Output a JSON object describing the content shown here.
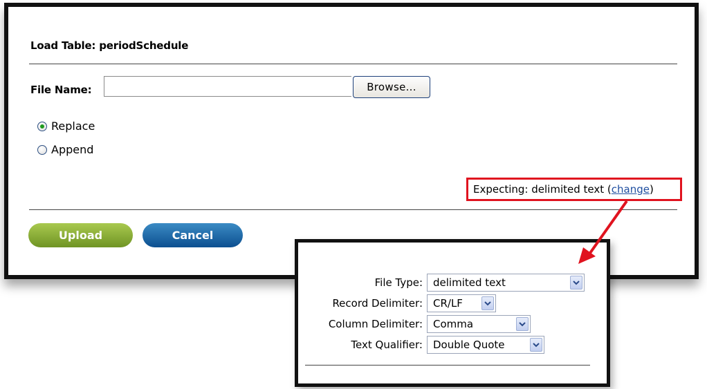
{
  "dialog": {
    "title": "Load Table:  periodSchedule",
    "file_name_label": "File Name:",
    "file_name_value": "",
    "browse_label": "Browse...",
    "radio_options": [
      {
        "label": "Replace",
        "checked": true
      },
      {
        "label": "Append",
        "checked": false
      }
    ],
    "expecting_prefix": "Expecting: delimited text (",
    "expecting_link": "change",
    "expecting_suffix": ")",
    "upload_label": "Upload",
    "cancel_label": "Cancel"
  },
  "format_popup": {
    "fields": [
      {
        "label": "File Type:",
        "value": "delimited text"
      },
      {
        "label": "Record Delimiter:",
        "value": "CR/LF"
      },
      {
        "label": "Column Delimiter:",
        "value": "Comma"
      },
      {
        "label": "Text Qualifier:",
        "value": "Double Quote"
      }
    ]
  },
  "colors": {
    "highlight_red": "#e0131f",
    "upload_green": "#8bb03a",
    "cancel_blue": "#1c66a8",
    "link_blue": "#1f4fa0"
  },
  "icons": [
    "radio-checked-icon",
    "radio-unchecked-icon",
    "chevron-down-icon",
    "red-pointer-arrow-icon"
  ]
}
